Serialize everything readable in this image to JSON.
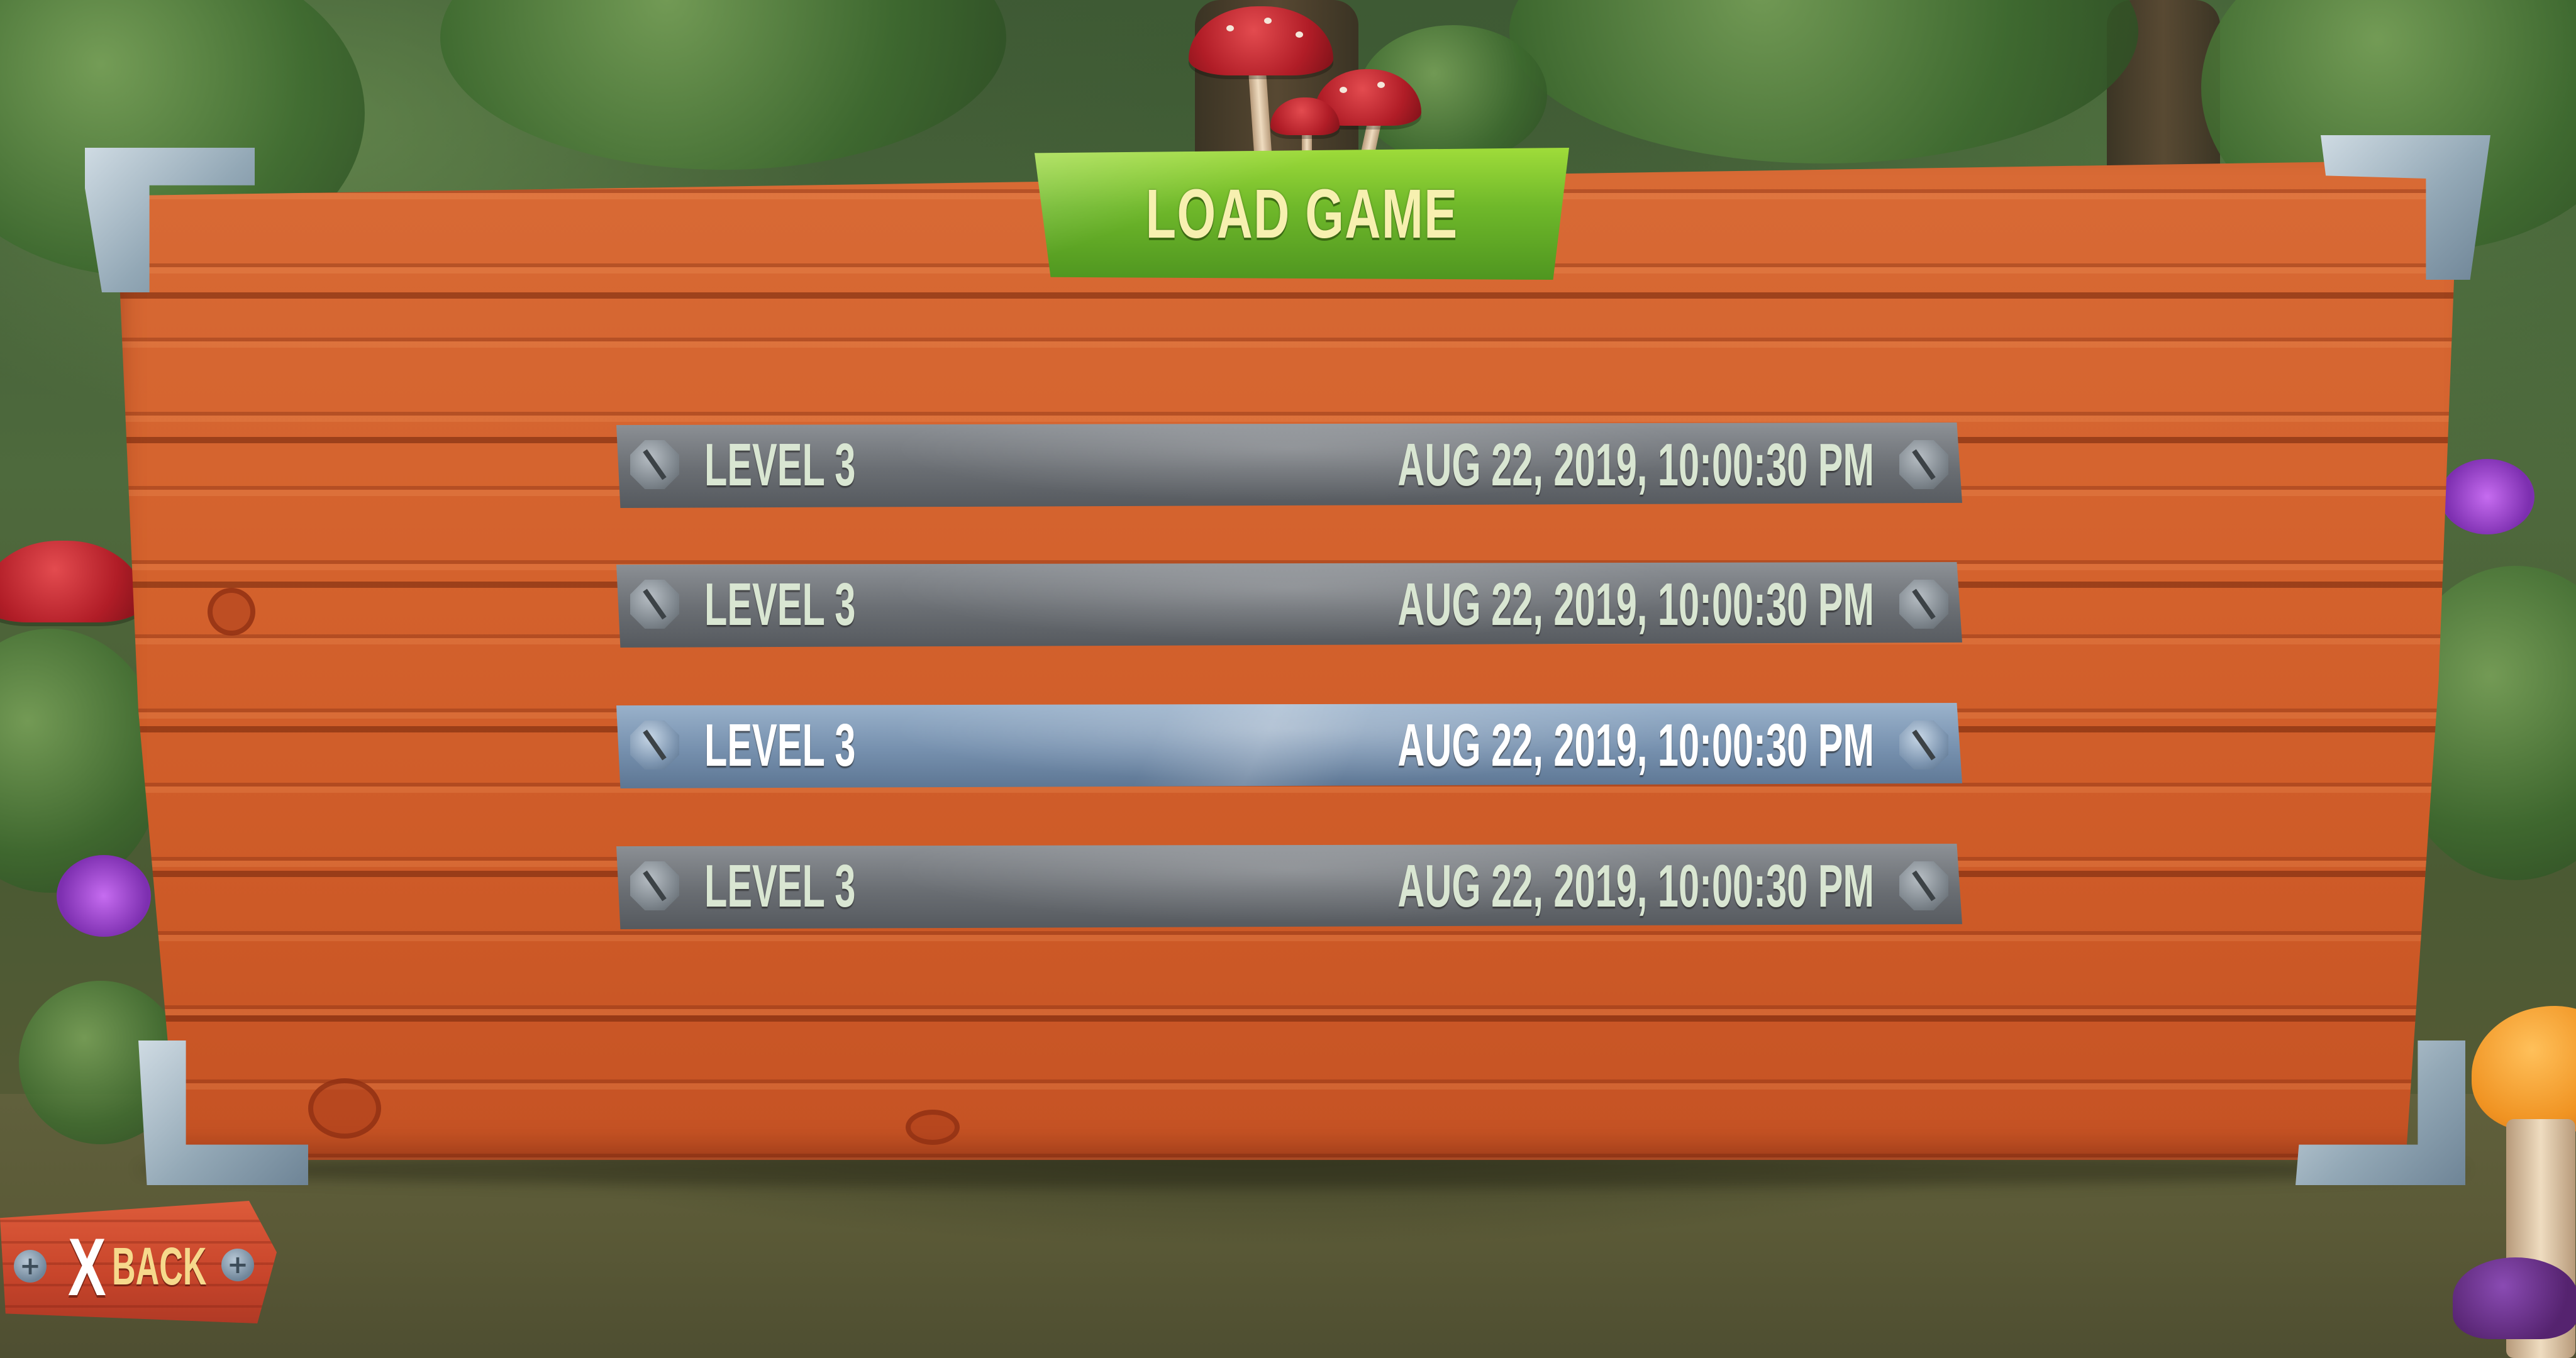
{
  "screen": {
    "title": "LOAD GAME"
  },
  "slots": [
    {
      "label": "LEVEL 3",
      "date": "AUG 22, 2019, 10:00:30 PM",
      "selected": false
    },
    {
      "label": "LEVEL 3",
      "date": "AUG 22, 2019, 10:00:30 PM",
      "selected": false
    },
    {
      "label": "LEVEL 3",
      "date": "AUG 22, 2019, 10:00:30 PM",
      "selected": true
    },
    {
      "label": "LEVEL 3",
      "date": "AUG 22, 2019, 10:00:30 PM",
      "selected": false
    }
  ],
  "back_button": {
    "key_hint": "X",
    "label": "BACK"
  },
  "colors": {
    "title_plaque": "#6fb82a",
    "board_wood": "#d4622d",
    "slot_default": "#6a6e73",
    "slot_selected": "#7690ae",
    "slot_text": "#d9e6d2",
    "back_label": "#f6d98c"
  },
  "icons": {
    "slot_screws": "screw-icon",
    "back_screws": "screw-icon",
    "back_key": "x-button-icon"
  }
}
